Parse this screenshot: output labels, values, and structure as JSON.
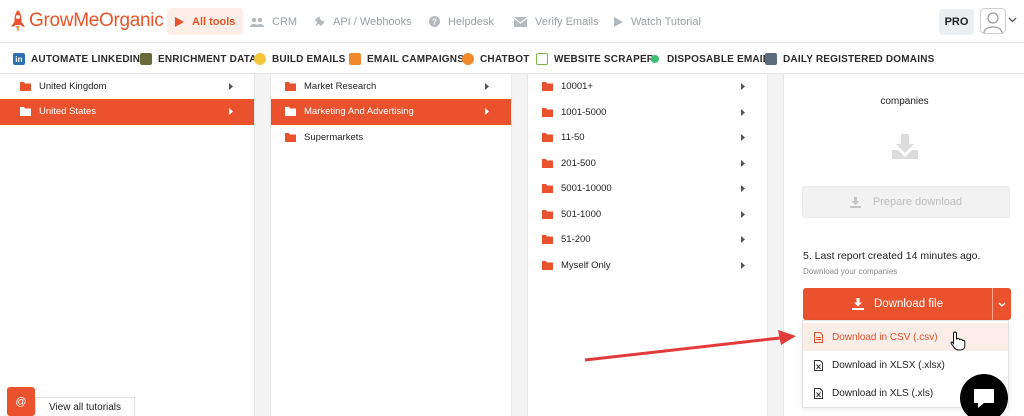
{
  "brand": {
    "name": "GrowMeOrganic",
    "accent": "#e9522c"
  },
  "nav": [
    {
      "label": "All tools",
      "icon": "play-icon",
      "active": true
    },
    {
      "label": "CRM",
      "icon": "users-icon"
    },
    {
      "label": "API / Webhooks",
      "icon": "plug-icon"
    },
    {
      "label": "Helpdesk",
      "icon": "question-icon"
    },
    {
      "label": "Verify Emails",
      "icon": "envelope-icon"
    },
    {
      "label": "Watch Tutorial",
      "icon": "play-outline-icon"
    }
  ],
  "user": {
    "plan": "PRO"
  },
  "tools": [
    {
      "label": "AUTOMATE LINKEDIN",
      "icon": "linkedin-icon"
    },
    {
      "label": "ENRICHMENT DATA",
      "icon": "data-icon"
    },
    {
      "label": "BUILD EMAILS",
      "icon": "build-icon"
    },
    {
      "label": "EMAIL CAMPAIGNS",
      "icon": "campaign-icon"
    },
    {
      "label": "CHATBOT",
      "icon": "chatbot-icon"
    },
    {
      "label": "WEBSITE SCRAPER",
      "icon": "scraper-icon"
    },
    {
      "label": "DISPOSABLE EMAIL",
      "icon": "disposable-icon"
    },
    {
      "label": "DAILY REGISTERED DOMAINS",
      "icon": "domains-icon"
    }
  ],
  "countries": [
    {
      "label": "United Kingdom",
      "active": false
    },
    {
      "label": "United States",
      "active": true
    }
  ],
  "industries": [
    {
      "label": "Market Research",
      "active": false
    },
    {
      "label": "Marketing And Advertising",
      "active": true
    },
    {
      "label": "Supermarkets",
      "active": false
    }
  ],
  "sizes": [
    {
      "label": "10001+"
    },
    {
      "label": "1001-5000"
    },
    {
      "label": "11-50"
    },
    {
      "label": "201-500"
    },
    {
      "label": "5001-10000"
    },
    {
      "label": "501-1000"
    },
    {
      "label": "51-200"
    },
    {
      "label": "Myself Only"
    }
  ],
  "panel": {
    "companies": "companies",
    "prepare_label": "Prepare download",
    "last_report": "5. Last report created 14 minutes ago.",
    "last_sub": "Download your companies",
    "download_label": "Download file",
    "dropdown": [
      {
        "label": "Download in CSV (.csv)",
        "selected": true
      },
      {
        "label": "Download in XLSX (.xlsx)",
        "selected": false
      },
      {
        "label": "Download in XLS (.xls)",
        "selected": false
      }
    ]
  },
  "footer": {
    "help_label": "@",
    "tutorials_label": "View all tutorials"
  }
}
